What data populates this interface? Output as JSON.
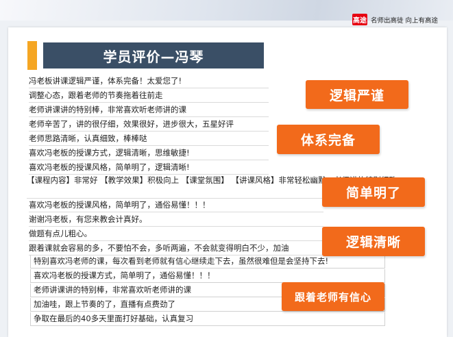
{
  "header": {
    "logo_mark": "高途",
    "logo_slogan": "名师出高徒 向上有高途"
  },
  "title": "学员评价—冯琴",
  "comments": [
    "冯老板讲课逻辑严谨，体系完备！太爱您了!",
    "调整心态，跟着老师的节奏拖着往前走",
    "老师讲课讲的特别棒，非常喜欢听老师讲的课",
    "老师辛苦了，讲的很仔细，效果很好，进步很大，五星好评",
    "老师思路清晰，认真细致，棒棒哒",
    "喜欢冯老板的授课方式，逻辑清晰，思维敏捷!",
    "喜欢冯老板的授课风格，简单明了，逻辑清晰!",
    "【课程内容】非常好 【教学效果】积极向上 【课堂氛围】 【讲课风格】非常轻松幽默，老师讲的特别细致",
    "喜欢冯老板的授课风格，简单明了，通俗易懂！！！",
    "谢谢冯老板，有您来教会计真好。",
    "做题有点儿粗心。",
    "跟着课就会容易的多，不要怕不会，多听两遍，不会就变得明白不少，加油",
    "特别喜欢冯老师的课，每次看到老师就有信心继续走下去，虽然很难但是会坚持下去!",
    "喜欢冯老板的授课方式，简单明了，通俗易懂！！！",
    "老师讲课讲的特别棒，非常喜欢听老师讲的课",
    "加油哇，跟上节奏的了，直播有点费劲了",
    "争取在最后的40多天里面打好基础，认真复习"
  ],
  "tags": [
    "逻辑严谨",
    "体系完备",
    "简单明了",
    "逻辑清晰",
    "跟着老师有信心"
  ],
  "colors": {
    "tag_orange": "#f26a1b",
    "title_bar": "#3a4f66",
    "accent_yellow": "#f5a623",
    "logo_red": "#e60012"
  }
}
